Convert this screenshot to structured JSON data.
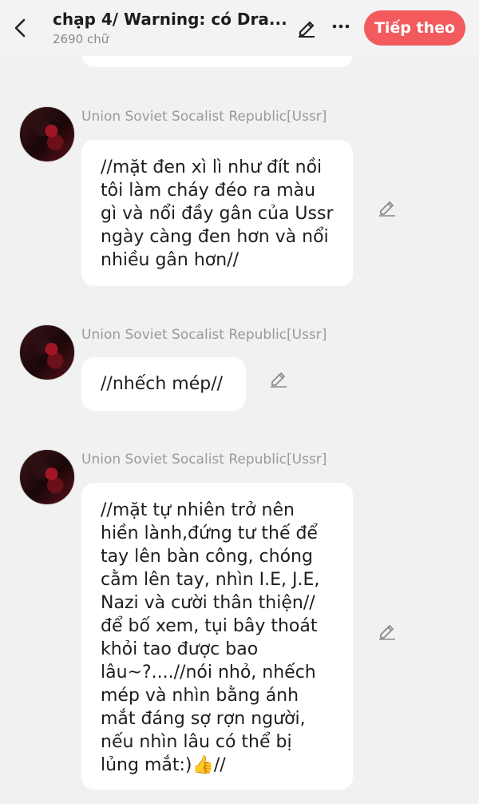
{
  "header": {
    "title": "chạp 4/ Warning: có Dra...",
    "word_count": "2690 chữ",
    "next_label": "Tiếp theo",
    "accent_color": "#f25a5d"
  },
  "messages": [
    {
      "sender": "Union Soviet Socalist Republic[Ussr]",
      "text": "//mặt đen xì lì như đít nồi tôi làm cháy đéo ra màu gì và nổi đầy gân của Ussr ngày càng đen hơn và nổi nhiều gân hơn//"
    },
    {
      "sender": "Union Soviet Socalist Republic[Ussr]",
      "text": "//nhếch mép//"
    },
    {
      "sender": "Union Soviet Socalist Republic[Ussr]",
      "text": "//mặt tự nhiên trở nên hiền lành,đứng tư thế để tay lên bàn công, chóng cằm lên tay, nhìn I.E, J.E, Nazi và cười thân thiện// để bố xem, tụi bây thoát khỏi tao được bao lâu~?....//nói nhỏ, nhếch mép và nhìn bằng ánh mắt đáng sợ rợn người, nếu nhìn lâu có thể bị lủng mắt:)👍//"
    }
  ],
  "icons": {
    "back": "chevron-left-icon",
    "edit": "pencil-icon",
    "more": "more-dots-icon"
  }
}
